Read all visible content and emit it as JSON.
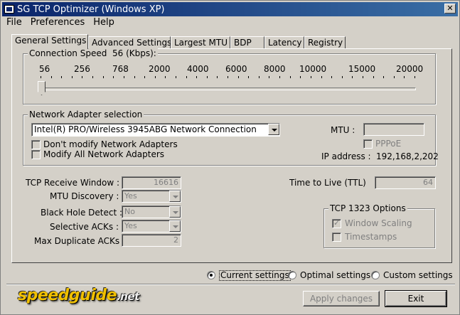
{
  "window": {
    "title": "SG TCP Optimizer (Windows XP)"
  },
  "menu": [
    "File",
    "Preferences",
    "Help"
  ],
  "tabs": [
    "General Settings",
    "Advanced Settings",
    "Largest MTU",
    "BDP",
    "Latency",
    "Registry"
  ],
  "active_tab": "General Settings",
  "speed": {
    "label": "Connection Speed",
    "value_text": "56 (Kbps):",
    "scale": [
      "56",
      "256",
      "768",
      "2000",
      "4000",
      "6000",
      "8000",
      "10000",
      "15000",
      "20000"
    ],
    "slider_value": "56"
  },
  "adapter": {
    "group_label": "Network Adapter selection",
    "selected": "Intel(R) PRO/Wireless 3945ABG Network Connection",
    "dont_modify": "Don't modify Network Adapters",
    "modify_all": "Modify All Network Adapters",
    "mtu_label": "MTU :",
    "mtu_value": "",
    "pppoe": "PPPoE",
    "ip_label": "IP address :",
    "ip": "192,168,2,202"
  },
  "tcp": {
    "receive_window_label": "TCP Receive Window :",
    "receive_window": "16616",
    "mtu_discovery_label": "MTU Discovery :",
    "mtu_discovery": "Yes",
    "black_hole_label": "Black Hole Detect :",
    "black_hole": "No",
    "sacks_label": "Selective ACKs :",
    "sacks": "Yes",
    "max_dup_label": "Max Duplicate ACKs :",
    "max_dup": "2",
    "ttl_label": "Time to Live (TTL)",
    "ttl": "64"
  },
  "rfc1323": {
    "label": "TCP 1323 Options",
    "window_scaling": "Window Scaling",
    "timestamps": "Timestamps"
  },
  "modes": {
    "current": "Current settings",
    "optimal": "Optimal settings",
    "custom": "Custom settings",
    "selected": "current"
  },
  "buttons": {
    "apply": "Apply changes",
    "exit": "Exit"
  },
  "logo": {
    "main": "speedguide",
    "suffix": ".net"
  }
}
